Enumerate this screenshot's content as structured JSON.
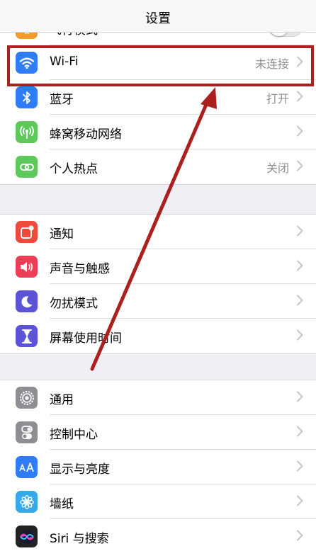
{
  "header": {
    "title": "设置"
  },
  "groups": {
    "network": {
      "airplane": {
        "label": "飞行模式",
        "icon": "airplane-icon",
        "toggle_on": false
      },
      "wifi": {
        "label": "Wi-Fi",
        "value": "未连接",
        "icon": "wifi-icon",
        "color": "#2f7cf6"
      },
      "bluetooth": {
        "label": "蓝牙",
        "value": "打开",
        "icon": "bluetooth-icon",
        "color": "#2f7cf6"
      },
      "cellular": {
        "label": "蜂窝移动网络",
        "icon": "cellular-icon",
        "color": "#5ec85c"
      },
      "hotspot": {
        "label": "个人热点",
        "value": "关闭",
        "icon": "hotspot-icon",
        "color": "#5ec85c"
      }
    },
    "alerts": {
      "notifications": {
        "label": "通知",
        "icon": "notifications-icon",
        "color": "#ee4b3c"
      },
      "sounds": {
        "label": "声音与触感",
        "icon": "speaker-icon",
        "color": "#ee3e55"
      },
      "dnd": {
        "label": "勿扰模式",
        "icon": "moon-icon",
        "color": "#5b54d6"
      },
      "screentime": {
        "label": "屏幕使用时间",
        "icon": "hourglass-icon",
        "color": "#5b54d6"
      }
    },
    "general": {
      "general": {
        "label": "通用",
        "icon": "gear-icon",
        "color": "#8e8e93"
      },
      "control": {
        "label": "控制中心",
        "icon": "switches-icon",
        "color": "#8e8e93"
      },
      "display": {
        "label": "显示与亮度",
        "icon": "text-size-icon",
        "color": "#2f7cf6"
      },
      "wallpaper": {
        "label": "墙纸",
        "icon": "flower-icon",
        "color": "#37a9e8"
      },
      "siri": {
        "label": "Siri 与搜索",
        "icon": "siri-icon",
        "color": "#222222"
      }
    }
  },
  "annotation": {
    "color": "#a9201f"
  }
}
